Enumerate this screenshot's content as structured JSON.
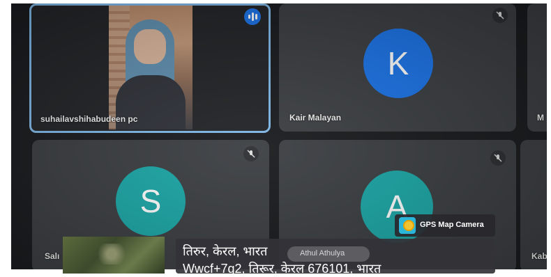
{
  "participants": [
    {
      "name": "suhailavshihabudeen pc",
      "state": "speaking"
    },
    {
      "name": "Kair Malayan",
      "initial": "K",
      "color": "#1a73e8",
      "state": "muted"
    },
    {
      "name": "M",
      "state": "partial"
    },
    {
      "name": "Salı",
      "initial": "S",
      "color": "#1aa6a6",
      "state": "muted"
    },
    {
      "name": "",
      "initial": "A",
      "color": "#1aa6a6",
      "state": "muted"
    },
    {
      "name": "Kab",
      "state": "partial"
    }
  ],
  "overlay": {
    "badge": "GPS Map Camera",
    "place": "तिरुर, केरल, भारत",
    "address": "Wwcf+7g2, तिरूर, केरल 676101, भारत",
    "pill_name": "Athul Athulya"
  }
}
